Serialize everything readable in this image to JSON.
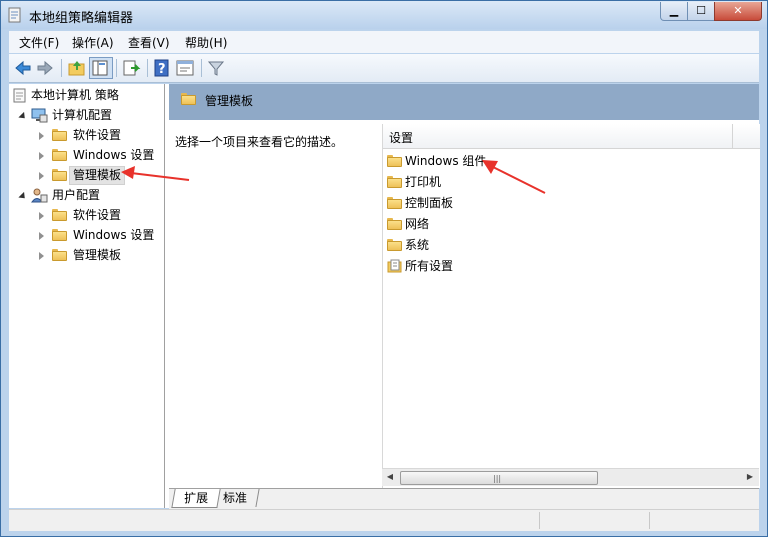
{
  "window": {
    "title": "本地组策略编辑器"
  },
  "menu": [
    {
      "label": "文件(F)"
    },
    {
      "label": "操作(A)"
    },
    {
      "label": "查看(V)"
    },
    {
      "label": "帮助(H)"
    }
  ],
  "toolbar_icons": [
    "back-icon",
    "forward-icon",
    "up-folder-icon",
    "show-tree-icon",
    "export-icon",
    "help-icon",
    "properties-icon",
    "filter-icon"
  ],
  "tree": {
    "root": "本地计算机 策略",
    "computer_config": "计算机配置",
    "computer_children": [
      "软件设置",
      "Windows 设置",
      "管理模板"
    ],
    "user_config": "用户配置",
    "user_children": [
      "软件设置",
      "Windows 设置",
      "管理模板"
    ]
  },
  "detail": {
    "title": "管理模板",
    "description": "选择一个项目来查看它的描述。",
    "column_header": "设置",
    "items": [
      "Windows 组件",
      "打印机",
      "控制面板",
      "网络",
      "系统",
      "所有设置"
    ]
  },
  "tabs": [
    "扩展",
    "标准"
  ],
  "colors": {
    "header_band": "#8fa9c7",
    "annotation_arrow": "#e8322b",
    "title_bar": "#b9d1ec"
  }
}
